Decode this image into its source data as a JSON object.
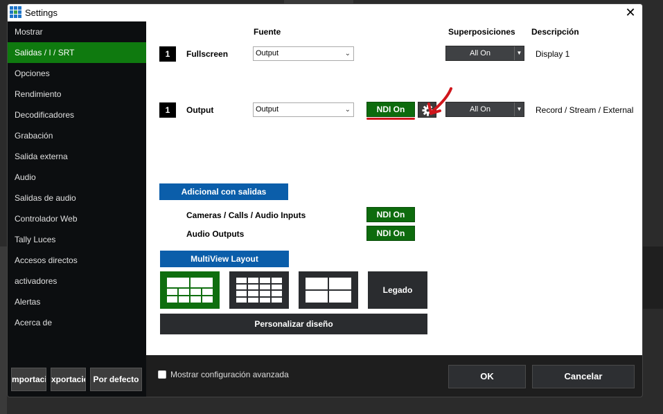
{
  "window": {
    "title": "Settings"
  },
  "sidebar": {
    "items": [
      {
        "label": "Mostrar"
      },
      {
        "label": "Salidas / I / SRT"
      },
      {
        "label": "Opciones"
      },
      {
        "label": "Rendimiento"
      },
      {
        "label": "Decodificadores"
      },
      {
        "label": "Grabación"
      },
      {
        "label": "Salida externa"
      },
      {
        "label": "Audio"
      },
      {
        "label": "Salidas de audio"
      },
      {
        "label": "Controlador Web"
      },
      {
        "label": "Tally Luces"
      },
      {
        "label": "Accesos directos"
      },
      {
        "label": "activadores"
      },
      {
        "label": "Alertas"
      },
      {
        "label": "Acerca de"
      }
    ],
    "active_index": 1,
    "buttons": {
      "import": "mportació",
      "export": "xportació",
      "default": "Por defecto"
    }
  },
  "headers": {
    "source": "Fuente",
    "overlays": "Superposiciones",
    "description": "Descripción"
  },
  "outputs": [
    {
      "number": "1",
      "name": "Fullscreen",
      "source": "Output",
      "overlay": "All On",
      "description": "Display 1"
    },
    {
      "number": "1",
      "name": "Output",
      "source": "Output",
      "ndi": "NDI On",
      "overlay": "All On",
      "description": "Record / Stream / External"
    }
  ],
  "additional": {
    "title": "Adicional con salidas",
    "rows": [
      {
        "label": "Cameras / Calls / Audio Inputs",
        "ndi": "NDI On"
      },
      {
        "label": "Audio Outputs",
        "ndi": "NDI On"
      }
    ]
  },
  "multiview": {
    "title": "MultiView Layout",
    "legacy_label": "Legado",
    "custom_label": "Personalizar diseño"
  },
  "footer": {
    "advanced_label": "Mostrar configuración avanzada",
    "advanced_checked": false,
    "ok": "OK",
    "cancel": "Cancelar"
  },
  "icons": {
    "app": "app-grid-icon",
    "close": "close-icon",
    "gear": "gear-icon",
    "dropdown": "chevron-down-icon"
  },
  "colors": {
    "active_green": "#0f7a0f",
    "ndi_green": "#0d6b0d",
    "blue": "#0b5eaa",
    "annotation_red": "#d0161c"
  }
}
